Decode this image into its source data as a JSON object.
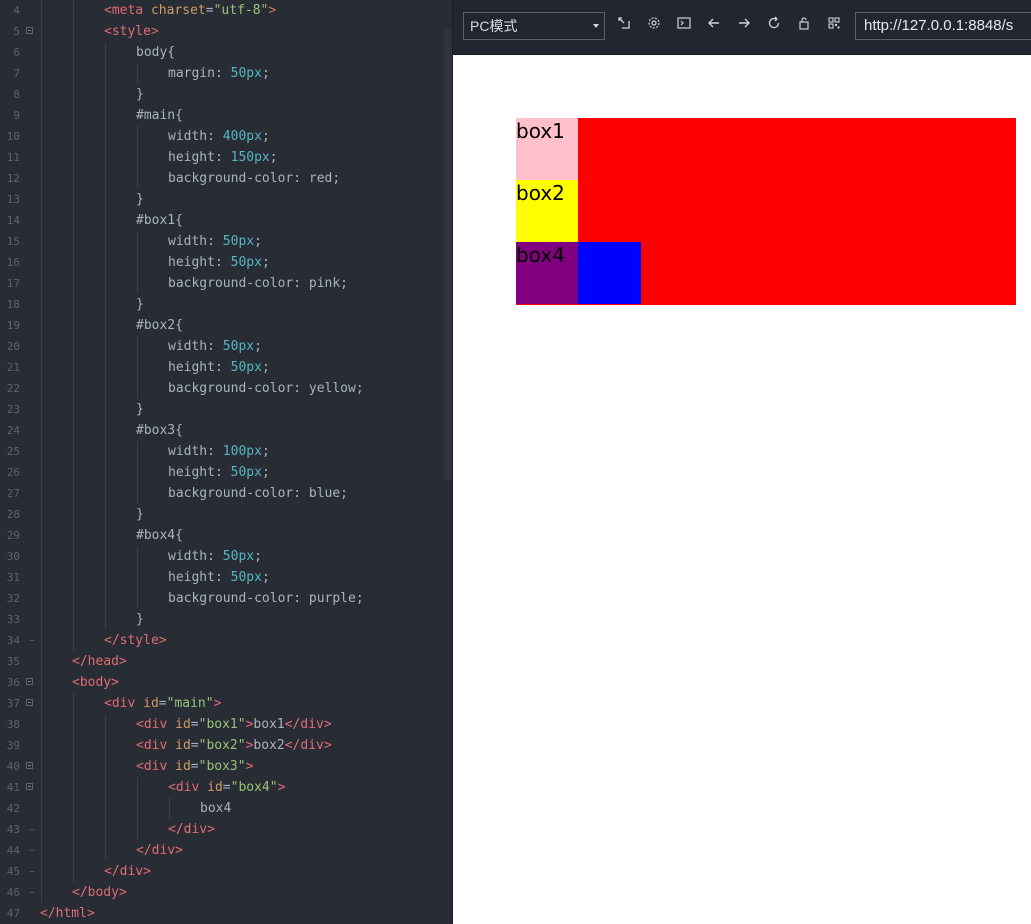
{
  "editor": {
    "lines": [
      {
        "n": "4",
        "tokens": [
          [
            "tag",
            "<meta "
          ],
          [
            "attr",
            "charset"
          ],
          [
            "txt",
            "="
          ],
          [
            "str",
            "\"utf-8\""
          ],
          [
            "tag",
            ">"
          ]
        ],
        "indent": 2
      },
      {
        "n": "5",
        "tokens": [
          [
            "tag",
            "<style>"
          ]
        ],
        "indent": 2,
        "fold": true
      },
      {
        "n": "6",
        "tokens": [
          [
            "sel",
            "body{"
          ]
        ],
        "indent": 3
      },
      {
        "n": "7",
        "tokens": [
          [
            "prop",
            "margin: "
          ],
          [
            "num",
            "50px"
          ],
          [
            "prop",
            ";"
          ]
        ],
        "indent": 4
      },
      {
        "n": "8",
        "tokens": [
          [
            "sel",
            "}"
          ]
        ],
        "indent": 3
      },
      {
        "n": "9",
        "tokens": [
          [
            "sel",
            "#main{"
          ]
        ],
        "indent": 3
      },
      {
        "n": "10",
        "tokens": [
          [
            "prop",
            "width: "
          ],
          [
            "num",
            "400px"
          ],
          [
            "prop",
            ";"
          ]
        ],
        "indent": 4
      },
      {
        "n": "11",
        "tokens": [
          [
            "prop",
            "height: "
          ],
          [
            "num",
            "150px"
          ],
          [
            "prop",
            ";"
          ]
        ],
        "indent": 4
      },
      {
        "n": "12",
        "tokens": [
          [
            "prop",
            "background-color: red;"
          ]
        ],
        "indent": 4
      },
      {
        "n": "13",
        "tokens": [
          [
            "sel",
            "}"
          ]
        ],
        "indent": 3
      },
      {
        "n": "14",
        "tokens": [
          [
            "sel",
            "#box1{"
          ]
        ],
        "indent": 3
      },
      {
        "n": "15",
        "tokens": [
          [
            "prop",
            "width: "
          ],
          [
            "num",
            "50px"
          ],
          [
            "prop",
            ";"
          ]
        ],
        "indent": 4
      },
      {
        "n": "16",
        "tokens": [
          [
            "prop",
            "height: "
          ],
          [
            "num",
            "50px"
          ],
          [
            "prop",
            ";"
          ]
        ],
        "indent": 4
      },
      {
        "n": "17",
        "tokens": [
          [
            "prop",
            "background-color: pink;"
          ]
        ],
        "indent": 4
      },
      {
        "n": "18",
        "tokens": [
          [
            "sel",
            "}"
          ]
        ],
        "indent": 3
      },
      {
        "n": "19",
        "tokens": [
          [
            "sel",
            "#box2{"
          ]
        ],
        "indent": 3
      },
      {
        "n": "20",
        "tokens": [
          [
            "prop",
            "width: "
          ],
          [
            "num",
            "50px"
          ],
          [
            "prop",
            ";"
          ]
        ],
        "indent": 4
      },
      {
        "n": "21",
        "tokens": [
          [
            "prop",
            "height: "
          ],
          [
            "num",
            "50px"
          ],
          [
            "prop",
            ";"
          ]
        ],
        "indent": 4
      },
      {
        "n": "22",
        "tokens": [
          [
            "prop",
            "background-color: yellow;"
          ]
        ],
        "indent": 4
      },
      {
        "n": "23",
        "tokens": [
          [
            "sel",
            "}"
          ]
        ],
        "indent": 3
      },
      {
        "n": "24",
        "tokens": [
          [
            "sel",
            "#box3{"
          ]
        ],
        "indent": 3
      },
      {
        "n": "25",
        "tokens": [
          [
            "prop",
            "width: "
          ],
          [
            "num",
            "100px"
          ],
          [
            "prop",
            ";"
          ]
        ],
        "indent": 4
      },
      {
        "n": "26",
        "tokens": [
          [
            "prop",
            "height: "
          ],
          [
            "num",
            "50px"
          ],
          [
            "prop",
            ";"
          ]
        ],
        "indent": 4
      },
      {
        "n": "27",
        "tokens": [
          [
            "prop",
            "background-color: blue;"
          ]
        ],
        "indent": 4
      },
      {
        "n": "28",
        "tokens": [
          [
            "sel",
            "}"
          ]
        ],
        "indent": 3
      },
      {
        "n": "29",
        "tokens": [
          [
            "sel",
            "#box4{"
          ]
        ],
        "indent": 3
      },
      {
        "n": "30",
        "tokens": [
          [
            "prop",
            "width: "
          ],
          [
            "num",
            "50px"
          ],
          [
            "prop",
            ";"
          ]
        ],
        "indent": 4
      },
      {
        "n": "31",
        "tokens": [
          [
            "prop",
            "height: "
          ],
          [
            "num",
            "50px"
          ],
          [
            "prop",
            ";"
          ]
        ],
        "indent": 4
      },
      {
        "n": "32",
        "tokens": [
          [
            "prop",
            "background-color: purple;"
          ]
        ],
        "indent": 4
      },
      {
        "n": "33",
        "tokens": [
          [
            "sel",
            "}"
          ]
        ],
        "indent": 3
      },
      {
        "n": "34",
        "tokens": [
          [
            "tag",
            "</style>"
          ]
        ],
        "indent": 2,
        "foldend": true
      },
      {
        "n": "35",
        "tokens": [
          [
            "tag",
            "</head>"
          ]
        ],
        "indent": 1
      },
      {
        "n": "36",
        "tokens": [
          [
            "tag",
            "<body>"
          ]
        ],
        "indent": 1,
        "fold": true
      },
      {
        "n": "37",
        "tokens": [
          [
            "tag",
            "<div "
          ],
          [
            "attr",
            "id"
          ],
          [
            "txt",
            "="
          ],
          [
            "str",
            "\"main\""
          ],
          [
            "tag",
            ">"
          ]
        ],
        "indent": 2,
        "fold": true
      },
      {
        "n": "38",
        "tokens": [
          [
            "tag",
            "<div "
          ],
          [
            "attr",
            "id"
          ],
          [
            "txt",
            "="
          ],
          [
            "str",
            "\"box1\""
          ],
          [
            "tag",
            ">"
          ],
          [
            "txt",
            "box1"
          ],
          [
            "tag",
            "</div>"
          ]
        ],
        "indent": 3
      },
      {
        "n": "39",
        "tokens": [
          [
            "tag",
            "<div "
          ],
          [
            "attr",
            "id"
          ],
          [
            "txt",
            "="
          ],
          [
            "str",
            "\"box2\""
          ],
          [
            "tag",
            ">"
          ],
          [
            "txt",
            "box2"
          ],
          [
            "tag",
            "</div>"
          ]
        ],
        "indent": 3
      },
      {
        "n": "40",
        "tokens": [
          [
            "tag",
            "<div "
          ],
          [
            "attr",
            "id"
          ],
          [
            "txt",
            "="
          ],
          [
            "str",
            "\"box3\""
          ],
          [
            "tag",
            ">"
          ]
        ],
        "indent": 3,
        "fold": true
      },
      {
        "n": "41",
        "tokens": [
          [
            "tag",
            "<div "
          ],
          [
            "attr",
            "id"
          ],
          [
            "txt",
            "="
          ],
          [
            "str",
            "\"box4\""
          ],
          [
            "tag",
            ">"
          ]
        ],
        "indent": 4,
        "fold": true
      },
      {
        "n": "42",
        "tokens": [
          [
            "txt",
            "box4"
          ]
        ],
        "indent": 5
      },
      {
        "n": "43",
        "tokens": [
          [
            "tag",
            "</div>"
          ]
        ],
        "indent": 4,
        "foldend": true
      },
      {
        "n": "44",
        "tokens": [
          [
            "tag",
            "</div>"
          ]
        ],
        "indent": 3,
        "foldend": true
      },
      {
        "n": "45",
        "tokens": [
          [
            "tag",
            "</div>"
          ]
        ],
        "indent": 2,
        "foldend": true
      },
      {
        "n": "46",
        "tokens": [
          [
            "tag",
            "</body>"
          ]
        ],
        "indent": 1,
        "foldend": true
      },
      {
        "n": "47",
        "tokens": [
          [
            "tag",
            "</html>"
          ]
        ],
        "indent": 0
      }
    ]
  },
  "browser": {
    "mode_label": "PC模式",
    "url": "http://127.0.0.1:8848/s",
    "icons": [
      "screenshot-icon",
      "settings-icon",
      "console-icon",
      "back-icon",
      "forward-icon",
      "reload-icon",
      "lock-icon",
      "qrcode-icon"
    ]
  },
  "preview": {
    "main_color": "#ff0000",
    "box1": {
      "label": "box1",
      "color": "#ffc0cb"
    },
    "box2": {
      "label": "box2",
      "color": "#ffff00"
    },
    "box3": {
      "color": "#0000ff"
    },
    "box4": {
      "label": "box4",
      "color": "#800080"
    }
  }
}
